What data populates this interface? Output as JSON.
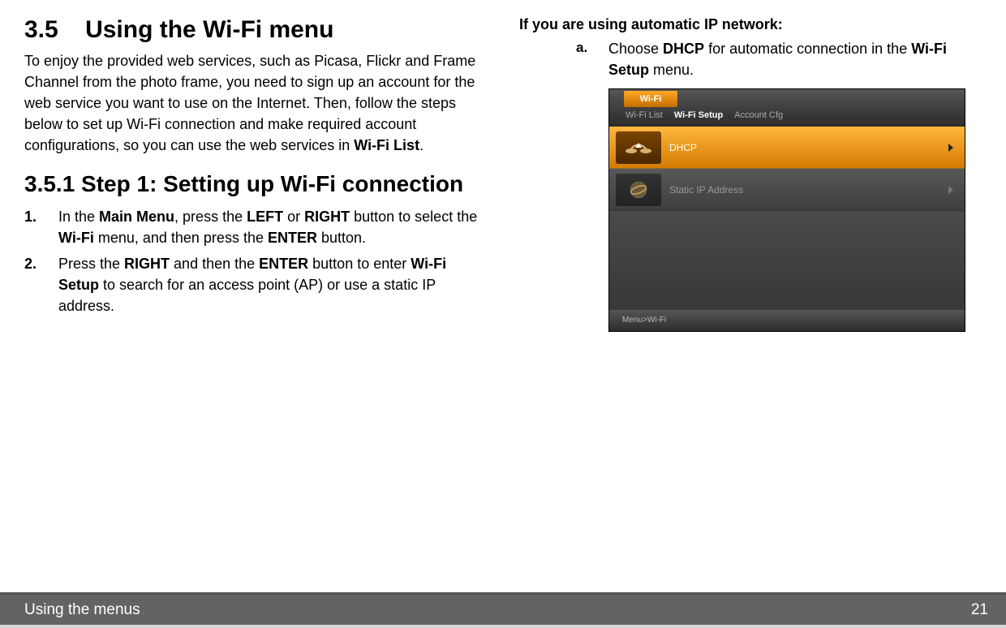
{
  "left": {
    "h1_num": "3.5",
    "h1_title": "Using the Wi-Fi menu",
    "intro_pre": "To enjoy the provided web services, such as Picasa, Flickr and Frame Channel from the photo frame, you need to sign up an account for the web service you want to use on the Internet. Then, follow the steps below to set up Wi-Fi connection and make required account configurations, so you can use the web services in ",
    "intro_bold": "Wi-Fi List",
    "intro_post": ".",
    "h2": "3.5.1   Step 1: Setting up Wi-Fi connection",
    "step1_num": "1.",
    "step1_a": "In the ",
    "step1_b": "Main Menu",
    "step1_c": ", press the ",
    "step1_d": "LEFT",
    "step1_e": " or ",
    "step1_f": "RIGHT",
    "step1_g": " button to select the ",
    "step1_h": "Wi-Fi",
    "step1_i": " menu, and then press the ",
    "step1_j": "ENTER",
    "step1_k": " button.",
    "step2_num": "2.",
    "step2_a": "Press the ",
    "step2_b": "RIGHT",
    "step2_c": " and then the ",
    "step2_d": "ENTER",
    "step2_e": " button to enter ",
    "step2_f": "Wi-Fi Setup",
    "step2_g": " to search for an access point (AP) or use a static IP address."
  },
  "right": {
    "subhead": "If you are using automatic IP network:",
    "a_num": "a.",
    "a_1": "Choose ",
    "a_2": "DHCP",
    "a_3": " for automatic connection in the ",
    "a_4": "Wi-Fi Setup",
    "a_5": " menu."
  },
  "device": {
    "title": "Wi-Fi",
    "tab1": "Wi-Fi  List",
    "tab2": "Wi-Fi Setup",
    "tab3": "Account Cfg",
    "row1": "DHCP",
    "row2": "Static IP Address",
    "breadcrumb": "Menu>Wi-Fi"
  },
  "footer": {
    "section": "Using the menus",
    "page": "21"
  }
}
